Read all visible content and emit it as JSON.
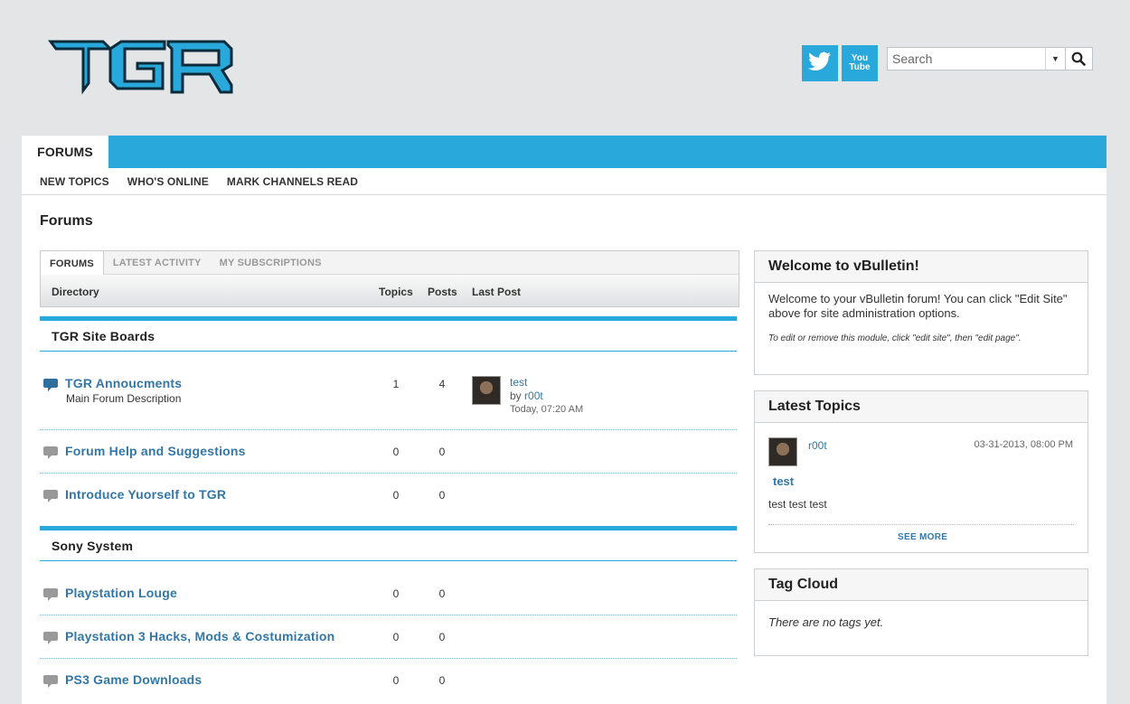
{
  "header": {
    "search_placeholder": "Search",
    "social": [
      "twitter-icon",
      "youtube-icon"
    ],
    "youtube_label": "You Tube"
  },
  "colors": {
    "accent": "#29a8db",
    "link": "#3277a8",
    "background": "#e4e5e6"
  },
  "nav": {
    "main_tab": "FORUMS",
    "sub_links": [
      "NEW TOPICS",
      "WHO'S ONLINE",
      "MARK CHANNELS READ"
    ]
  },
  "page_title": "Forums",
  "forum_tabs": [
    "FORUMS",
    "LATEST ACTIVITY",
    "MY SUBSCRIPTIONS"
  ],
  "directory_header": {
    "directory": "Directory",
    "topics": "Topics",
    "posts": "Posts",
    "last_post": "Last Post"
  },
  "sections": [
    {
      "title": "TGR Site Boards",
      "forums": [
        {
          "name": "TGR Annoucments",
          "description": "Main Forum Description",
          "topics": "1",
          "posts": "4",
          "last_post": {
            "title": "test",
            "by": "by",
            "user": "r00t",
            "time": "Today, 07:20 AM"
          }
        },
        {
          "name": "Forum Help and Suggestions",
          "topics": "0",
          "posts": "0"
        },
        {
          "name": "Introduce Yuorself to TGR",
          "topics": "0",
          "posts": "0"
        }
      ]
    },
    {
      "title": "Sony System",
      "forums": [
        {
          "name": "Playstation Louge",
          "topics": "0",
          "posts": "0"
        },
        {
          "name": "Playstation 3 Hacks, Mods & Costumization",
          "topics": "0",
          "posts": "0"
        },
        {
          "name": "PS3 Game Downloads",
          "topics": "0",
          "posts": "0"
        }
      ]
    }
  ],
  "sidebar": {
    "welcome": {
      "title": "Welcome to vBulletin!",
      "text": "Welcome to your vBulletin forum! You can click \"Edit Site\" above for site administration options.",
      "note": "To edit or remove this module, click \"edit site\", then \"edit page\"."
    },
    "latest_topics": {
      "title": "Latest Topics",
      "user": "r00t",
      "date": "03-31-2013, 08:00 PM",
      "topic": "test",
      "excerpt": "test test test",
      "see_more": "SEE MORE"
    },
    "tag_cloud": {
      "title": "Tag Cloud",
      "empty": "There are no tags yet."
    }
  }
}
